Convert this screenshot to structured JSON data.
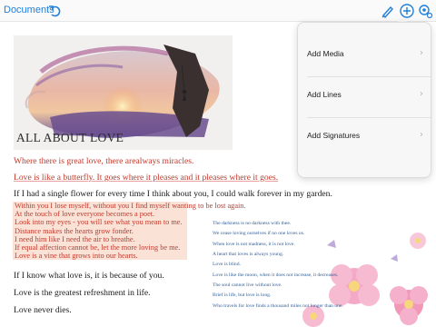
{
  "toolbar": {
    "documents_label": "Documents",
    "icons": [
      "undo-icon",
      "pen-icon",
      "add-icon",
      "settings-icon"
    ],
    "accent": "#1f7fd9"
  },
  "document": {
    "hero_title": "ALL ABOUT LOVE",
    "lines": {
      "l1": "Where there is great love, there arealways miracles.",
      "l2": "Love is like a butterfly. It goes where it pleases and it pleases where it goes.",
      "l3": "If I had a single flower for every time I think about you, I could walk forever in my garden."
    },
    "poem": [
      "Within you I lose myself, without you I find myself wanting to be lost again.",
      "At the touch of love everyone becomes a poet.",
      "Look into my eyes - you will see what you mean to me.",
      "Distance makes the hearts grow fonder.",
      "I need him like I need the air to breathe.",
      "If equal affection cannot be, let the more loving be me.",
      "Love is a vine that grows into our hearts."
    ],
    "quotes": [
      "The darkness is no darkness with thee.",
      "We cease loving ourselves if no one loves us.",
      "When love is not madness, it is not love.",
      "A heart that loves is always young.",
      "Love is blind.",
      "Love is like the moon, when it does not increase, it decreases.",
      "The soul cannot live without love.",
      "Brief is life, but love is long.",
      "Who travels for love finds a thousand miles not longer than one."
    ],
    "closing": {
      "c1": "If I know what love is, it is because of you.",
      "c2": "Love is the greatest refreshment in life.",
      "c3": "Love never dies."
    },
    "colors": {
      "red_text": "#c0392b",
      "highlight": "#fbe2d7",
      "blue_text": "#2f5e9a"
    }
  },
  "popover": {
    "items": [
      {
        "label": "Add Media"
      },
      {
        "label": "Add Lines"
      },
      {
        "label": "Add Signatures"
      }
    ]
  }
}
